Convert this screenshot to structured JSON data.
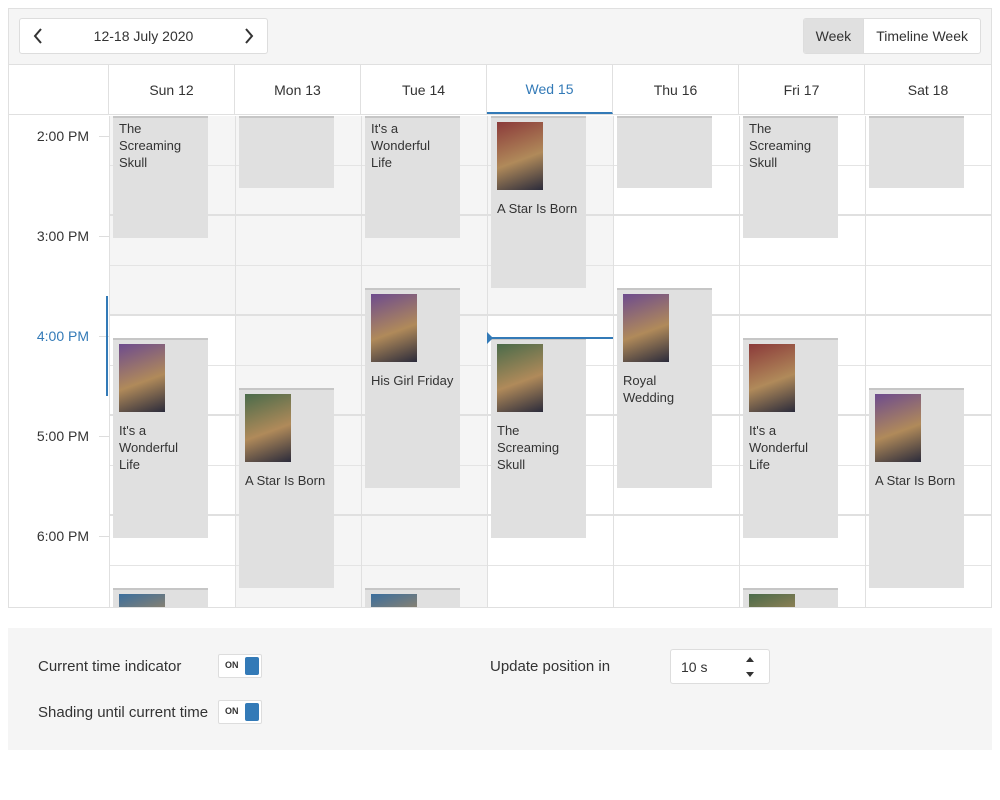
{
  "toolbar": {
    "date_range": "12-18 July 2020",
    "prev_icon": "chevron-left-icon",
    "next_icon": "chevron-right-icon",
    "views": [
      {
        "label": "Week",
        "active": true
      },
      {
        "label": "Timeline Week",
        "active": false
      }
    ]
  },
  "days": [
    "Sun 12",
    "Mon 13",
    "Tue 14",
    "Wed 15",
    "Thu 16",
    "Fri 17",
    "Sat 18"
  ],
  "today": "Wed 15",
  "time_labels": [
    "2:00 PM",
    "3:00 PM",
    "4:00 PM",
    "5:00 PM",
    "6:00 PM"
  ],
  "current_time_label": "4:00 PM",
  "appointments": [
    {
      "title": "The Screaming Skull",
      "day": "Sun 12",
      "poster": false
    },
    {
      "title": "It's a Wonderful Life",
      "day": "Sun 12",
      "poster": true
    },
    {
      "title": "",
      "day": "Sun 12",
      "poster": true
    },
    {
      "title": "",
      "day": "Mon 13",
      "poster": false
    },
    {
      "title": "A Star Is Born",
      "day": "Mon 13",
      "poster": true
    },
    {
      "title": "It's a Wonderful Life",
      "day": "Tue 14",
      "poster": false
    },
    {
      "title": "His Girl Friday",
      "day": "Tue 14",
      "poster": true
    },
    {
      "title": "",
      "day": "Tue 14",
      "poster": true
    },
    {
      "title": "A Star Is Born",
      "day": "Wed 15",
      "poster": true
    },
    {
      "title": "The Screaming Skull",
      "day": "Wed 15",
      "poster": true
    },
    {
      "title": "",
      "day": "Thu 16",
      "poster": false
    },
    {
      "title": "Royal Wedding",
      "day": "Thu 16",
      "poster": true
    },
    {
      "title": "The Screaming Skull",
      "day": "Fri 17",
      "poster": false
    },
    {
      "title": "It's a Wonderful Life",
      "day": "Fri 17",
      "poster": true
    },
    {
      "title": "",
      "day": "Fri 17",
      "poster": true
    },
    {
      "title": "",
      "day": "Sat 18",
      "poster": false
    },
    {
      "title": "A Star Is Born",
      "day": "Sat 18",
      "poster": true
    }
  ],
  "options": {
    "current_time_indicator": {
      "label": "Current time indicator",
      "switch_text": "ON",
      "on": true
    },
    "shading_until_current_time": {
      "label": "Shading until current time",
      "switch_text": "ON",
      "on": true
    },
    "update_position": {
      "label": "Update position in",
      "value": "10 s"
    }
  },
  "colors": {
    "accent": "#337ab7",
    "appointment": "#e0e0e0",
    "shading": "#f5f5f5"
  }
}
